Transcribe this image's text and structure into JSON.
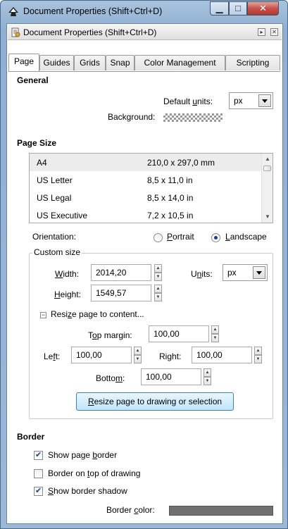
{
  "window": {
    "title": "Document Properties (Shift+Ctrl+D)"
  },
  "dock": {
    "title": "Document Properties (Shift+Ctrl+D)"
  },
  "tabs": [
    "Page",
    "Guides",
    "Grids",
    "Snap",
    "Color Management",
    "Scripting"
  ],
  "general": {
    "heading": "General",
    "default_units_label_pre": "Default ",
    "default_units_label_u": "u",
    "default_units_label_post": "nits:",
    "default_units_value": "px",
    "background_label": "Background:"
  },
  "page_size": {
    "heading": "Page Size",
    "rows": [
      {
        "name": "A4",
        "size": "210,0 x 297,0 mm"
      },
      {
        "name": "US Letter",
        "size": "8,5 x 11,0 in"
      },
      {
        "name": "US Legal",
        "size": "8,5 x 14,0 in"
      },
      {
        "name": "US Executive",
        "size": "7,2 x 10,5 in"
      }
    ],
    "orientation_label": "Orientation:",
    "portrait_label_u": "P",
    "portrait_label_rest": "ortrait",
    "landscape_label_u": "L",
    "landscape_label_rest": "andscape"
  },
  "custom_size": {
    "legend": "Custom size",
    "width_label_u": "W",
    "width_label_rest": "idth:",
    "width_value": "2014,20",
    "units_label_pre": "U",
    "units_label_u": "n",
    "units_label_rest": "its:",
    "units_value": "px",
    "height_label_u": "H",
    "height_label_rest": "eight:",
    "height_value": "1549,57",
    "resize_expander_label_pre": "Resi",
    "resize_expander_label_u": "z",
    "resize_expander_label_rest": "e page to content...",
    "top_margin_label_pre": "T",
    "top_margin_label_u": "o",
    "top_margin_label_rest": "p margin:",
    "top_margin_value": "100,00",
    "left_label_pre": "Le",
    "left_label_u": "f",
    "left_label_rest": "t:",
    "left_value": "100,00",
    "right_label_pre": "Ri",
    "right_label_u": "g",
    "right_label_rest": "ht:",
    "right_value": "100,00",
    "bottom_label_pre": "Botto",
    "bottom_label_u": "m",
    "bottom_label_rest": ":",
    "bottom_value": "100,00",
    "resize_button_u": "R",
    "resize_button_rest": "esize page to drawing or selection"
  },
  "border": {
    "heading": "Border",
    "show_page_border_pre": "Show page ",
    "show_page_border_u": "b",
    "show_page_border_rest": "order",
    "show_page_border_checked": true,
    "border_on_top_pre": "Border on ",
    "border_on_top_u": "t",
    "border_on_top_rest": "op of drawing",
    "border_on_top_checked": false,
    "show_shadow_u": "S",
    "show_shadow_rest": "how border shadow",
    "show_shadow_checked": true,
    "border_color_pre": "Border ",
    "border_color_u": "c",
    "border_color_rest": "olor:",
    "border_color_value": "#707070"
  },
  "colors": {
    "window_frame": "#9ab8d8",
    "close_button": "#c75050",
    "button_highlight": "#bee6fd"
  }
}
